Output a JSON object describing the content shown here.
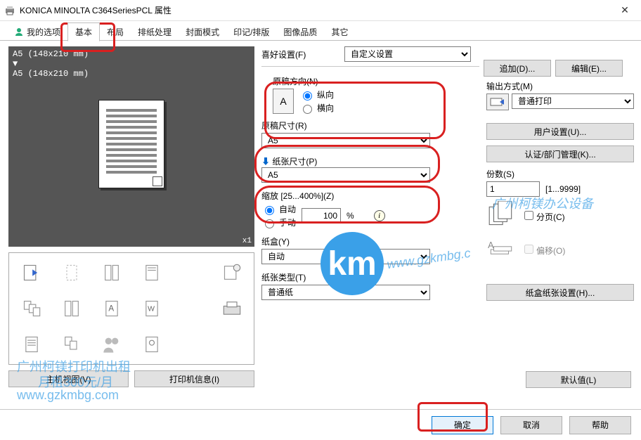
{
  "title": "KONICA MINOLTA C364SeriesPCL 属性",
  "tabs": {
    "myoptions": "我的选项",
    "basic": "基本",
    "layout": "布局",
    "output": "排纸处理",
    "cover": "封面模式",
    "watermark": "印记/排版",
    "quality": "图像品质",
    "other": "其它"
  },
  "preview": {
    "line1": "A5 (148x210 mm)",
    "line2": "A5 (148x210 mm)",
    "count": "x1"
  },
  "leftButtons": {
    "hostView": "主机视图(V)",
    "printerInfo": "打印机信息(I)"
  },
  "favorites": {
    "label": "喜好设置(F)",
    "value": "自定义设置",
    "addBtn": "追加(D)...",
    "editBtn": "编辑(E)..."
  },
  "orientation": {
    "label": "原稿方向(N)",
    "portrait": "纵向",
    "landscape": "横向"
  },
  "originalSize": {
    "label": "原稿尺寸(R)",
    "value": "A5"
  },
  "paperSize": {
    "label": "纸张尺寸(P)",
    "value": "A5"
  },
  "zoom": {
    "label": "缩放 [25...400%](Z)",
    "auto": "自动",
    "manual": "手动",
    "value": "100"
  },
  "tray": {
    "label": "纸盒(Y)",
    "value": "自动"
  },
  "paperType": {
    "label": "纸张类型(T)",
    "value": "普通纸"
  },
  "outputMethod": {
    "label": "输出方式(M)",
    "value": "普通打印"
  },
  "sideButtons": {
    "userSettings": "用户设置(U)...",
    "auth": "认证/部门管理(K)..."
  },
  "copies": {
    "label": "份数(S)",
    "value": "1",
    "range": "[1...9999]"
  },
  "collate": "分页(C)",
  "offset": "偏移(O)",
  "traySettings": "纸盒纸张设置(H)...",
  "defaultBtn": "默认值(L)",
  "footer": {
    "ok": "确定",
    "cancel": "取消",
    "help": "帮助"
  },
  "wm": {
    "big": "km",
    "l1": "广州柯镁打印机出租",
    "l2": "月租300元/月",
    "l3": "www.gzkmbg.com",
    "l4": "广州柯镁办公设备",
    "l5": "www.gzkmbg.c"
  }
}
